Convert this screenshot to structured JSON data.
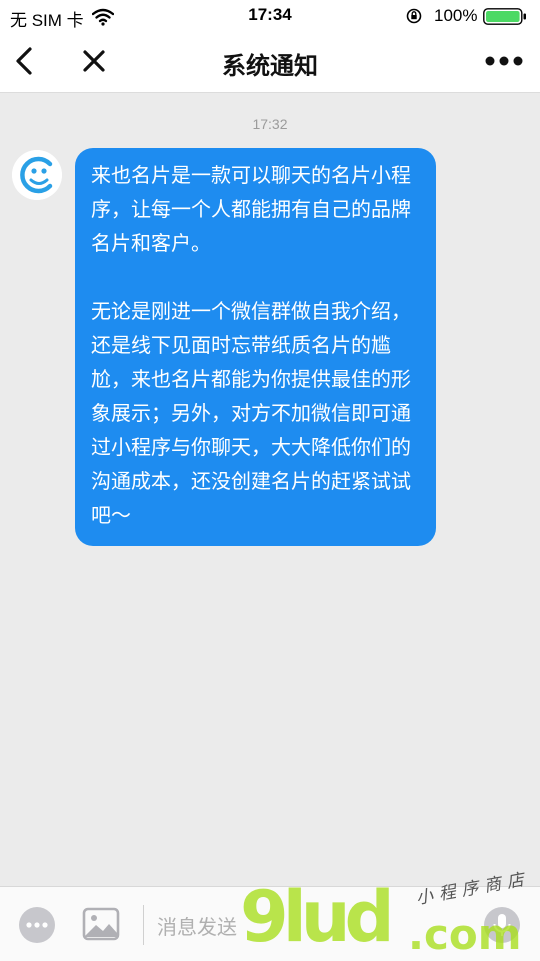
{
  "status_bar": {
    "carrier": "无 SIM 卡",
    "time": "17:34",
    "battery_percent": "100%",
    "battery_level": 1.0,
    "icons": [
      "wifi-icon",
      "orientation-lock-icon",
      "battery-icon"
    ]
  },
  "nav": {
    "title": "系统通知",
    "icons": [
      "back-chevron-icon",
      "close-icon",
      "more-dots-icon"
    ]
  },
  "chat": {
    "timestamp": "17:32",
    "avatar_icon": "smiley-icon",
    "message_paragraphs": [
      "来也名片是一款可以聊天的名片小程序，让每一个人都能拥有自己的品牌名片和客户。",
      "无论是刚进一个微信群做自我介绍，还是线下见面时忘带纸质名片的尴尬，来也名片都能为你提供最佳的形象展示；另外，对方不加微信即可通过小程序与你聊天，大大降低你们的沟通成本，还没创建名片的赶紧试试吧～"
    ]
  },
  "input_bar": {
    "placeholder": "消息发送",
    "icons": [
      "emoji-icon",
      "image-icon",
      "mic-icon"
    ]
  },
  "watermark": {
    "logo": "9lud",
    "domain": ".com",
    "subtitle": "小程序商店"
  },
  "colors": {
    "bubble": "#1e8cf0",
    "background": "#ebebeb",
    "avatar_accent": "#2aa0e6",
    "watermark": "#a8df1a"
  }
}
